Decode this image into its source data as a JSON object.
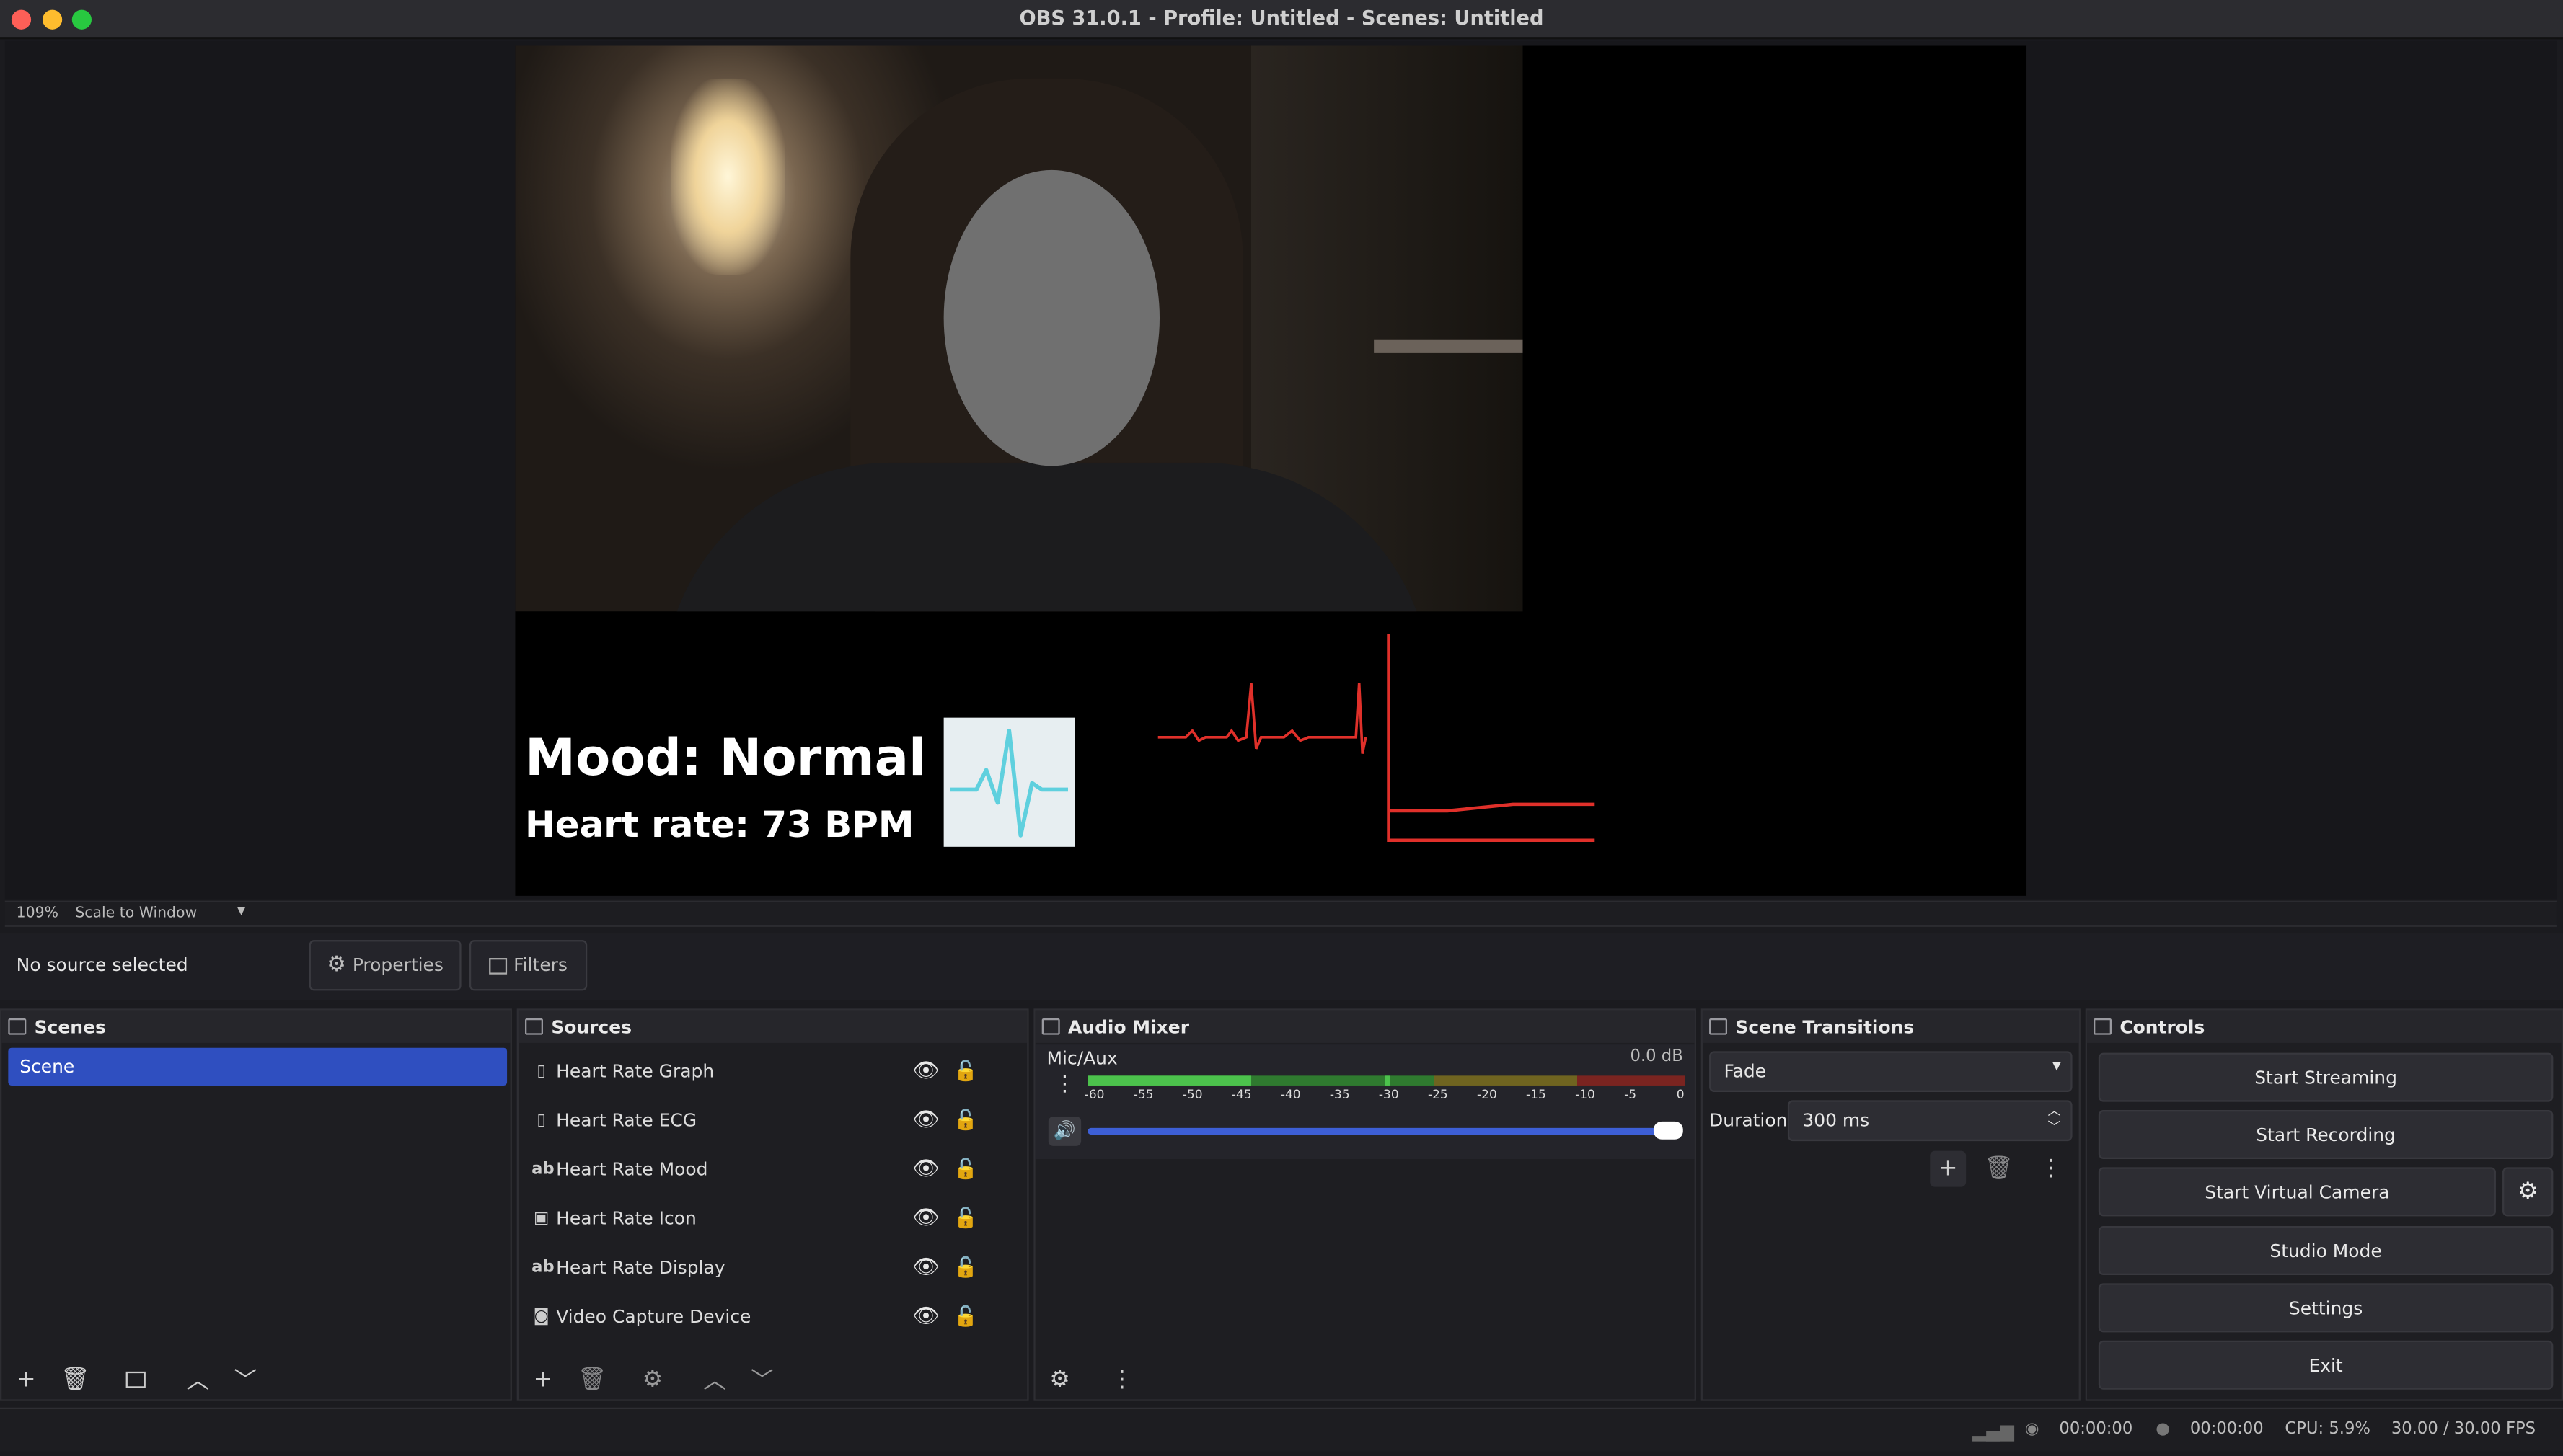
{
  "window": {
    "title": "OBS 31.0.1 - Profile: Untitled - Scenes: Untitled"
  },
  "preview": {
    "mood_text": "Mood: Normal",
    "heart_rate_text": "Heart rate: 73 BPM"
  },
  "zoombar": {
    "zoom": "109%",
    "scale_mode": "Scale to Window"
  },
  "context": {
    "no_source": "No source selected",
    "properties": "Properties",
    "filters": "Filters"
  },
  "scenes": {
    "title": "Scenes",
    "items": [
      "Scene"
    ]
  },
  "sources": {
    "title": "Sources",
    "items": [
      {
        "name": "Heart Rate Graph",
        "icon": "page-icon"
      },
      {
        "name": "Heart Rate ECG",
        "icon": "page-icon"
      },
      {
        "name": "Heart Rate Mood",
        "icon": "text-icon"
      },
      {
        "name": "Heart Rate Icon",
        "icon": "image-icon"
      },
      {
        "name": "Heart Rate Display",
        "icon": "text-icon"
      },
      {
        "name": "Video Capture Device",
        "icon": "camera-icon"
      }
    ]
  },
  "audio": {
    "title": "Audio Mixer",
    "channel": "Mic/Aux",
    "level": "0.0 dB",
    "ticks": [
      "-60",
      "-55",
      "-50",
      "-45",
      "-40",
      "-35",
      "-30",
      "-25",
      "-20",
      "-15",
      "-10",
      "-5",
      "0"
    ],
    "volume": 1.0
  },
  "transitions": {
    "title": "Scene Transitions",
    "selected": "Fade",
    "duration_label": "Duration",
    "duration_value": "300 ms"
  },
  "controls": {
    "title": "Controls",
    "start_streaming": "Start Streaming",
    "start_recording": "Start Recording",
    "start_virtual_camera": "Start Virtual Camera",
    "studio_mode": "Studio Mode",
    "settings": "Settings",
    "exit": "Exit"
  },
  "status": {
    "stream_time": "00:00:00",
    "record_time": "00:00:00",
    "cpu": "CPU: 5.9%",
    "fps": "30.00 / 30.00 FPS"
  },
  "colors": {
    "accent": "#2f4fc0",
    "ecg": "#e0302a",
    "meter_green": "#4cc24c",
    "meter_yellow": "#b7a330",
    "meter_red": "#c0392b"
  }
}
